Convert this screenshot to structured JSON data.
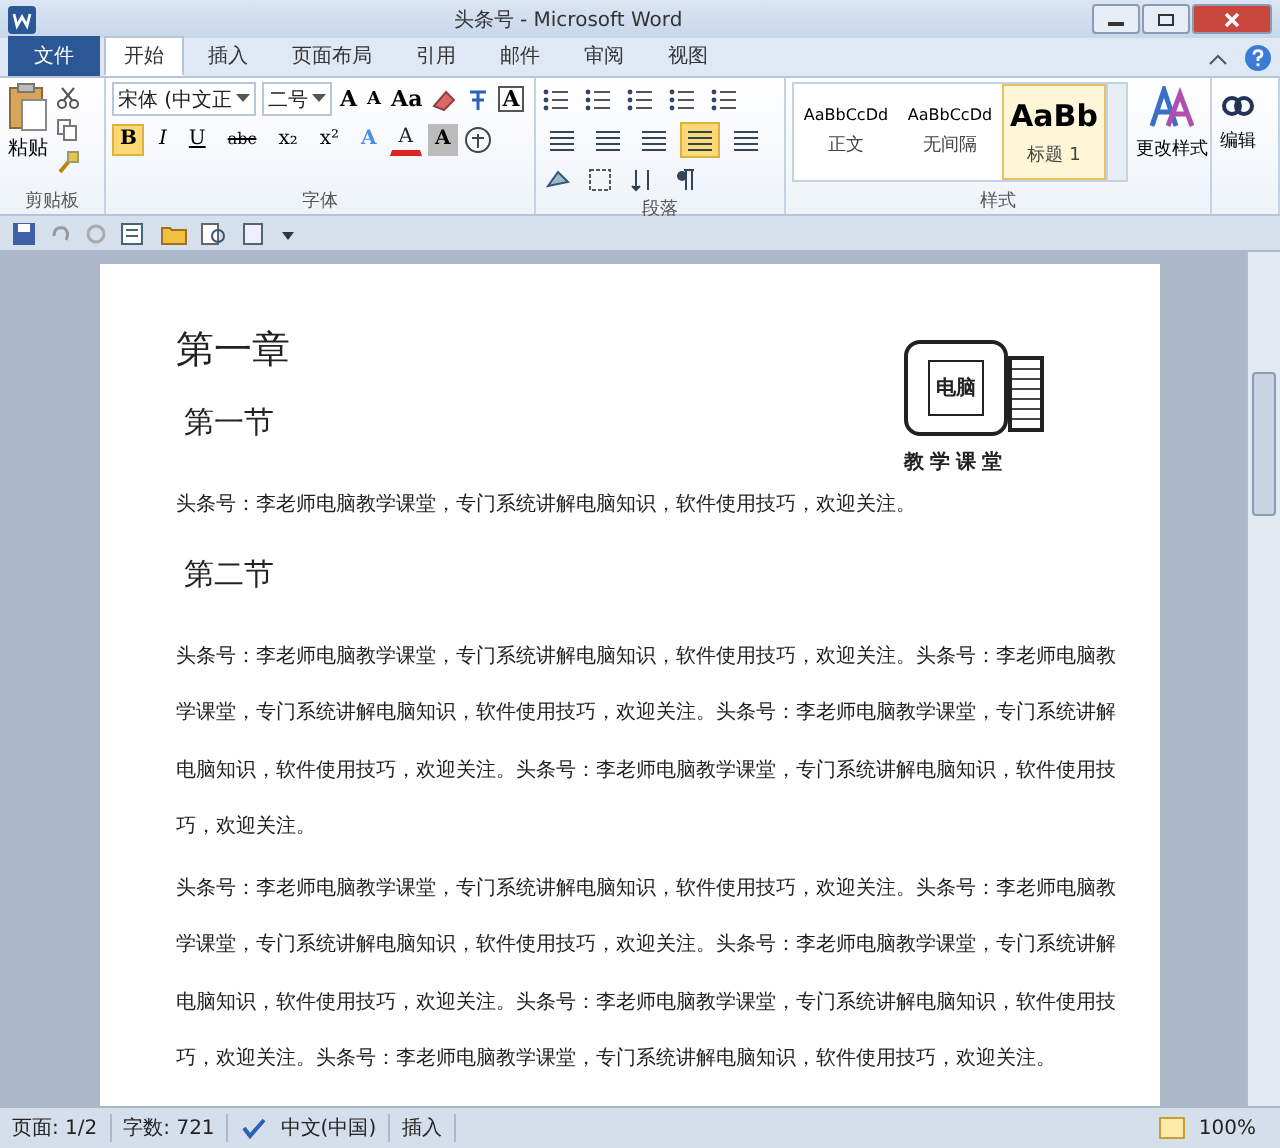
{
  "window": {
    "title": "头条号 - Microsoft Word"
  },
  "tabs": [
    {
      "label": "文件",
      "kind": "file",
      "selected": false
    },
    {
      "label": "开始",
      "kind": "tab",
      "selected": true
    },
    {
      "label": "插入",
      "kind": "tab",
      "selected": false
    },
    {
      "label": "页面布局",
      "kind": "tab",
      "selected": false
    },
    {
      "label": "引用",
      "kind": "tab",
      "selected": false
    },
    {
      "label": "邮件",
      "kind": "tab",
      "selected": false
    },
    {
      "label": "审阅",
      "kind": "tab",
      "selected": false
    },
    {
      "label": "视图",
      "kind": "tab",
      "selected": false
    }
  ],
  "ribbon": {
    "clipboard": {
      "paste": "粘贴",
      "label": "剪贴板"
    },
    "font": {
      "label": "字体",
      "font_name": "宋体 (中文正",
      "font_size": "二号",
      "grow": "A",
      "shrink": "A",
      "case": "Aa",
      "border": "A",
      "format_buttons": [
        {
          "glyph": "B",
          "kind": "bold",
          "selected": true
        },
        {
          "glyph": "I",
          "kind": "italic",
          "selected": false
        },
        {
          "glyph": "U",
          "kind": "underline",
          "selected": false
        },
        {
          "glyph": "abc",
          "kind": "strike",
          "selected": false
        },
        {
          "glyph": "x₂",
          "kind": "sub",
          "selected": false
        },
        {
          "glyph": "x²",
          "kind": "sup",
          "selected": false
        },
        {
          "glyph": "A",
          "kind": "effect",
          "selected": false
        },
        {
          "glyph": "A",
          "kind": "color",
          "selected": false
        },
        {
          "glyph": "A",
          "kind": "shade",
          "selected": false
        }
      ]
    },
    "paragraph": {
      "label": "段落",
      "align": [
        {
          "selected": false
        },
        {
          "selected": false
        },
        {
          "selected": false
        },
        {
          "selected": true
        },
        {
          "selected": false
        }
      ]
    },
    "styles": {
      "label": "样式",
      "items": [
        {
          "sample": "AaBbCcDd",
          "name": "正文",
          "kind": "normal",
          "selected": false
        },
        {
          "sample": "AaBbCcDd",
          "name": "无间隔",
          "kind": "normal",
          "selected": false
        },
        {
          "sample": "AaBb",
          "name": "标题 1",
          "kind": "heading",
          "selected": true
        }
      ],
      "change": "更改样式"
    },
    "editing": {
      "label": "编辑"
    }
  },
  "document": {
    "blocks": [
      {
        "kind": "h1",
        "text": "第一章"
      },
      {
        "kind": "h2",
        "text": "第一节"
      },
      {
        "kind": "p",
        "text": "头条号：李老师电脑教学课堂，专门系统讲解电脑知识，软件使用技巧，欢迎关注。"
      },
      {
        "kind": "h2",
        "text": "第二节"
      },
      {
        "kind": "p",
        "text": "头条号：李老师电脑教学课堂，专门系统讲解电脑知识，软件使用技巧，欢迎关注。头条号：李老师电脑教学课堂，专门系统讲解电脑知识，软件使用技巧，欢迎关注。头条号：李老师电脑教学课堂，专门系统讲解电脑知识，软件使用技巧，欢迎关注。头条号：李老师电脑教学课堂，专门系统讲解电脑知识，软件使用技巧，欢迎关注。"
      },
      {
        "kind": "p",
        "text": "头条号：李老师电脑教学课堂，专门系统讲解电脑知识，软件使用技巧，欢迎关注。头条号：李老师电脑教学课堂，专门系统讲解电脑知识，软件使用技巧，欢迎关注。头条号：李老师电脑教学课堂，专门系统讲解电脑知识，软件使用技巧，欢迎关注。头条号：李老师电脑教学课堂，专门系统讲解电脑知识，软件使用技巧，欢迎关注。头条号：李老师电脑教学课堂，专门系统讲解电脑知识，软件使用技巧，欢迎关注。"
      }
    ],
    "logo": {
      "screen_text": "电脑",
      "caption": "教学课堂"
    }
  },
  "status_bar": {
    "page": "页面: 1/2",
    "words": "字数: 721",
    "language": "中文(中国)",
    "mode": "插入",
    "zoom": "100%"
  }
}
